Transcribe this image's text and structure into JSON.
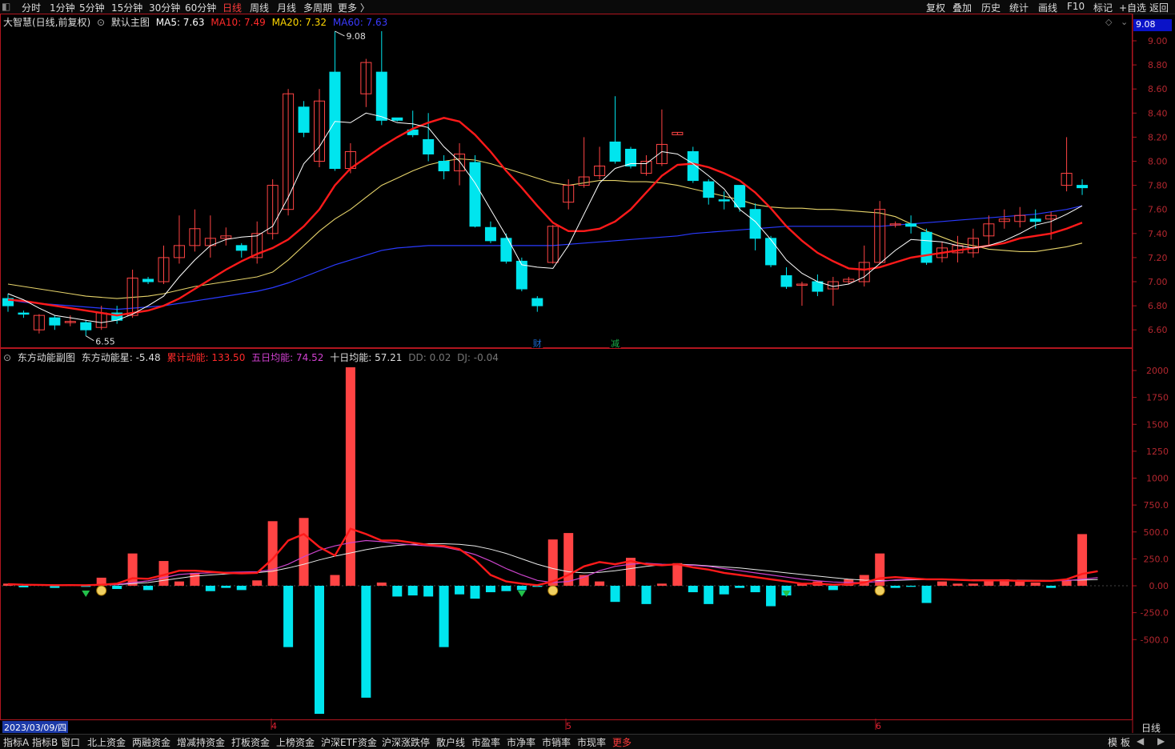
{
  "topbar": {
    "periods": [
      "分时",
      "1分钟",
      "5分钟",
      "15分钟",
      "30分钟",
      "60分钟",
      "日线",
      "周线",
      "月线",
      "多周期",
      "更多 〉"
    ],
    "active_period": "日线",
    "right_tools": [
      "复权",
      "叠加",
      "历史",
      "统计",
      "画线",
      "F10",
      "标记",
      "+自选",
      "返回"
    ]
  },
  "main": {
    "title": "大智慧(日线,前复权)",
    "template": "默认主图",
    "ma": [
      {
        "label": "MA5: 7.63",
        "color": "#ffffff"
      },
      {
        "label": "MA10: 7.49",
        "color": "#ff2a2a"
      },
      {
        "label": "MA20: 7.32",
        "color": "#ffd700"
      },
      {
        "label": "MA60: 7.63",
        "color": "#3a3aff"
      }
    ],
    "high_mark": "9.08",
    "low_mark": "6.55",
    "current_price": "9.08",
    "y_ticks": [
      "9.00",
      "8.80",
      "8.60",
      "8.40",
      "8.20",
      "8.00",
      "7.80",
      "7.60",
      "7.40",
      "7.20",
      "7.00",
      "6.80",
      "6.60"
    ],
    "events": [
      "财",
      "减"
    ]
  },
  "sub": {
    "title": "东方动能副图",
    "star_label": "东方动能星: -5.48",
    "cum_label": "累计动能: 133.50",
    "ma5_label": "五日均能: 74.52",
    "ma10_label": "十日均能: 57.21",
    "dd_label": "DD: 0.02",
    "dj_label": "DJ: -0.04",
    "y_ticks": [
      "2000",
      "1750",
      "1500",
      "1250",
      "1000",
      "750.0",
      "500.0",
      "250.0",
      "0.00",
      "-250.0",
      "-500.0"
    ]
  },
  "x_axis": {
    "date": "2023/03/09/四",
    "months": [
      "4",
      "5",
      "6"
    ],
    "period_label": "日线"
  },
  "bottombar": {
    "tabs": [
      "指标A",
      "指标B",
      "窗口",
      "北上资金",
      "两融资金",
      "增减持资金",
      "打板资金",
      "上榜资金",
      "沪深ETF资金",
      "沪深涨跌停",
      "散户线",
      "市盈率",
      "市净率",
      "市销率",
      "市现率",
      "更多"
    ],
    "right": [
      "模",
      "板"
    ]
  },
  "colors": {
    "up": "#ff4444",
    "down": "#00e5ee",
    "ma5": "#ffffff",
    "ma10": "#ff1a1a",
    "ma20": "#e6d36a",
    "ma60": "#2a3aff",
    "magenta": "#cc44cc",
    "axis": "#b0151f"
  },
  "chart_data": {
    "type": "candlestick",
    "candles": [
      [
        6.86,
        6.8,
        6.9,
        6.75
      ],
      [
        6.74,
        6.73,
        6.76,
        6.7
      ],
      [
        6.6,
        6.72,
        6.73,
        6.57
      ],
      [
        6.7,
        6.64,
        6.72,
        6.6
      ],
      [
        6.66,
        6.67,
        6.72,
        6.63
      ],
      [
        6.66,
        6.6,
        6.68,
        6.55
      ],
      [
        6.62,
        6.74,
        6.8,
        6.6
      ],
      [
        6.74,
        6.68,
        6.8,
        6.65
      ],
      [
        6.72,
        7.03,
        7.1,
        6.7
      ],
      [
        7.02,
        7.0,
        7.04,
        6.98
      ],
      [
        7.0,
        7.2,
        7.3,
        6.98
      ],
      [
        7.2,
        7.3,
        7.55,
        7.15
      ],
      [
        7.3,
        7.44,
        7.6,
        7.25
      ],
      [
        7.3,
        7.36,
        7.55,
        7.2
      ],
      [
        7.36,
        7.38,
        7.45,
        7.3
      ],
      [
        7.3,
        7.26,
        7.32,
        7.2
      ],
      [
        7.2,
        7.4,
        7.5,
        7.15
      ],
      [
        7.4,
        7.8,
        7.85,
        7.35
      ],
      [
        7.6,
        8.56,
        8.6,
        7.55
      ],
      [
        8.45,
        8.24,
        8.5,
        8.2
      ],
      [
        8.0,
        8.5,
        8.6,
        7.95
      ],
      [
        8.74,
        7.94,
        9.08,
        7.92
      ],
      [
        7.94,
        8.08,
        8.15,
        7.9
      ],
      [
        8.56,
        8.82,
        8.85,
        8.45
      ],
      [
        8.74,
        8.34,
        9.08,
        8.3
      ],
      [
        8.36,
        8.34,
        8.36,
        8.33
      ],
      [
        8.26,
        8.22,
        8.42,
        8.2
      ],
      [
        8.18,
        8.06,
        8.4,
        8.0
      ],
      [
        8.0,
        7.92,
        8.05,
        7.85
      ],
      [
        7.92,
        8.06,
        8.15,
        7.8
      ],
      [
        7.99,
        7.46,
        8.05,
        7.45
      ],
      [
        7.45,
        7.34,
        7.5,
        7.32
      ],
      [
        7.36,
        7.17,
        7.4,
        7.15
      ],
      [
        7.17,
        6.94,
        7.2,
        6.92
      ],
      [
        6.86,
        6.8,
        6.88,
        6.75
      ],
      [
        7.16,
        7.46,
        7.47,
        7.15
      ],
      [
        7.66,
        7.8,
        7.85,
        7.6
      ],
      [
        7.8,
        7.87,
        8.2,
        7.78
      ],
      [
        7.88,
        7.96,
        8.12,
        7.85
      ],
      [
        8.16,
        8.0,
        8.54,
        7.98
      ],
      [
        8.1,
        7.96,
        8.12,
        7.94
      ],
      [
        7.9,
        8.0,
        8.05,
        7.88
      ],
      [
        7.98,
        8.14,
        8.43,
        7.96
      ],
      [
        8.22,
        8.24,
        8.24,
        8.22
      ],
      [
        8.08,
        7.84,
        8.12,
        7.82
      ],
      [
        7.83,
        7.7,
        7.85,
        7.64
      ],
      [
        7.68,
        7.67,
        7.75,
        7.6
      ],
      [
        7.8,
        7.62,
        7.8,
        7.58
      ],
      [
        7.6,
        7.36,
        7.65,
        7.26
      ],
      [
        7.36,
        7.14,
        7.38,
        7.12
      ],
      [
        7.05,
        6.96,
        7.12,
        6.94
      ],
      [
        6.98,
        6.98,
        7.0,
        6.8
      ],
      [
        7.0,
        6.92,
        7.06,
        6.88
      ],
      [
        6.94,
        7.0,
        7.04,
        6.8
      ],
      [
        7.0,
        7.02,
        7.04,
        6.98
      ],
      [
        7.0,
        7.16,
        7.3,
        6.96
      ],
      [
        7.16,
        7.6,
        7.67,
        7.15
      ],
      [
        7.48,
        7.48,
        7.5,
        7.45
      ],
      [
        7.48,
        7.46,
        7.55,
        7.4
      ],
      [
        7.41,
        7.16,
        7.44,
        7.14
      ],
      [
        7.2,
        7.28,
        7.33,
        7.16
      ],
      [
        7.24,
        7.3,
        7.38,
        7.16
      ],
      [
        7.24,
        7.36,
        7.44,
        7.2
      ],
      [
        7.38,
        7.48,
        7.55,
        7.3
      ],
      [
        7.5,
        7.52,
        7.6,
        7.44
      ],
      [
        7.5,
        7.55,
        7.62,
        7.45
      ],
      [
        7.52,
        7.5,
        7.6,
        7.44
      ],
      [
        7.52,
        7.55,
        7.58,
        7.35
      ],
      [
        7.8,
        7.9,
        8.2,
        7.75
      ],
      [
        7.8,
        7.78,
        7.85,
        7.72
      ]
    ],
    "ma5": [
      6.9,
      6.85,
      6.78,
      6.72,
      6.7,
      6.68,
      6.66,
      6.68,
      6.73,
      6.8,
      6.88,
      7.04,
      7.18,
      7.3,
      7.35,
      7.37,
      7.38,
      7.46,
      7.7,
      7.98,
      8.12,
      8.33,
      8.32,
      8.4,
      8.37,
      8.32,
      8.31,
      8.28,
      8.12,
      8.0,
      7.82,
      7.6,
      7.38,
      7.14,
      7.12,
      7.11,
      7.3,
      7.56,
      7.82,
      7.94,
      7.98,
      7.98,
      8.08,
      8.06,
      7.98,
      7.88,
      7.77,
      7.6,
      7.5,
      7.35,
      7.18,
      7.07,
      7.0,
      6.96,
      6.98,
      7.04,
      7.15,
      7.26,
      7.35,
      7.34,
      7.33,
      7.3,
      7.28,
      7.3,
      7.34,
      7.4,
      7.47,
      7.5,
      7.56,
      7.63
    ],
    "ma10": [
      6.85,
      6.84,
      6.82,
      6.8,
      6.78,
      6.76,
      6.74,
      6.72,
      6.74,
      6.76,
      6.8,
      6.86,
      6.94,
      7.02,
      7.1,
      7.17,
      7.23,
      7.28,
      7.35,
      7.46,
      7.6,
      7.8,
      7.94,
      8.03,
      8.12,
      8.2,
      8.27,
      8.32,
      8.36,
      8.33,
      8.22,
      8.08,
      7.92,
      7.78,
      7.63,
      7.49,
      7.42,
      7.42,
      7.44,
      7.5,
      7.6,
      7.74,
      7.88,
      7.97,
      7.98,
      7.95,
      7.9,
      7.84,
      7.74,
      7.61,
      7.46,
      7.34,
      7.24,
      7.17,
      7.11,
      7.1,
      7.12,
      7.16,
      7.2,
      7.22,
      7.24,
      7.26,
      7.28,
      7.3,
      7.32,
      7.36,
      7.38,
      7.4,
      7.44,
      7.49
    ],
    "ma20": [
      6.98,
      6.96,
      6.94,
      6.92,
      6.9,
      6.88,
      6.87,
      6.86,
      6.87,
      6.88,
      6.9,
      6.93,
      6.96,
      6.98,
      7.0,
      7.02,
      7.04,
      7.08,
      7.18,
      7.3,
      7.42,
      7.52,
      7.6,
      7.7,
      7.8,
      7.86,
      7.92,
      7.97,
      8.0,
      8.02,
      8.01,
      7.98,
      7.94,
      7.9,
      7.86,
      7.82,
      7.8,
      7.82,
      7.84,
      7.84,
      7.83,
      7.83,
      7.82,
      7.8,
      7.77,
      7.74,
      7.71,
      7.68,
      7.64,
      7.62,
      7.61,
      7.61,
      7.6,
      7.6,
      7.59,
      7.58,
      7.57,
      7.54,
      7.48,
      7.42,
      7.37,
      7.32,
      7.3,
      7.27,
      7.26,
      7.25,
      7.25,
      7.27,
      7.29,
      7.32
    ],
    "ma60": [
      6.85,
      6.83,
      6.82,
      6.81,
      6.8,
      6.79,
      6.78,
      6.77,
      6.78,
      6.79,
      6.8,
      6.82,
      6.84,
      6.86,
      6.88,
      6.9,
      6.92,
      6.95,
      6.99,
      7.04,
      7.09,
      7.14,
      7.18,
      7.22,
      7.26,
      7.28,
      7.29,
      7.3,
      7.3,
      7.3,
      7.3,
      7.3,
      7.3,
      7.3,
      7.3,
      7.3,
      7.31,
      7.32,
      7.33,
      7.34,
      7.35,
      7.36,
      7.37,
      7.38,
      7.4,
      7.41,
      7.42,
      7.43,
      7.44,
      7.45,
      7.46,
      7.46,
      7.46,
      7.46,
      7.46,
      7.46,
      7.46,
      7.47,
      7.48,
      7.49,
      7.5,
      7.51,
      7.52,
      7.53,
      7.54,
      7.55,
      7.56,
      7.58,
      7.6,
      7.63
    ],
    "bars": [
      20,
      -15,
      10,
      -20,
      10,
      -10,
      75,
      -30,
      300,
      -40,
      230,
      40,
      120,
      -50,
      -20,
      -40,
      50,
      600,
      -570,
      630,
      -1190,
      100,
      2030,
      -1040,
      30,
      -100,
      -90,
      -100,
      -570,
      -80,
      -120,
      -60,
      -50,
      -40,
      -10,
      430,
      490,
      100,
      40,
      -150,
      260,
      -170,
      20,
      210,
      -60,
      -170,
      -80,
      -20,
      -60,
      -190,
      -90,
      20,
      40,
      -40,
      60,
      100,
      300,
      -20,
      -10,
      -160,
      40,
      20,
      20,
      50,
      60,
      40,
      30,
      -20,
      50,
      480,
      20
    ],
    "cum": [
      15,
      10,
      8,
      5,
      6,
      5,
      10,
      20,
      70,
      65,
      100,
      140,
      140,
      130,
      120,
      115,
      120,
      250,
      420,
      480,
      360,
      280,
      530,
      480,
      420,
      420,
      400,
      380,
      370,
      340,
      240,
      100,
      40,
      20,
      5,
      40,
      100,
      180,
      220,
      200,
      230,
      200,
      190,
      200,
      170,
      150,
      120,
      100,
      80,
      60,
      40,
      20,
      20,
      10,
      15,
      30,
      70,
      80,
      70,
      60,
      60,
      55,
      50,
      50,
      50,
      45,
      45,
      45,
      60,
      110,
      135
    ],
    "ma5e": [
      10,
      8,
      7,
      6,
      6,
      6,
      8,
      12,
      30,
      45,
      75,
      105,
      115,
      120,
      125,
      128,
      130,
      150,
      200,
      270,
      330,
      370,
      400,
      420,
      410,
      390,
      380,
      370,
      360,
      330,
      290,
      230,
      160,
      100,
      50,
      30,
      40,
      80,
      140,
      180,
      200,
      210,
      200,
      195,
      190,
      180,
      160,
      140,
      120,
      100,
      80,
      60,
      45,
      35,
      30,
      30,
      40,
      55,
      60,
      60,
      60,
      55,
      50,
      50,
      50,
      48,
      46,
      45,
      48,
      60,
      75
    ],
    "ma10e": [
      10,
      9,
      8,
      8,
      7,
      7,
      8,
      10,
      20,
      30,
      50,
      70,
      90,
      100,
      110,
      118,
      122,
      135,
      165,
      200,
      240,
      275,
      305,
      335,
      360,
      375,
      385,
      390,
      390,
      385,
      370,
      340,
      300,
      250,
      200,
      160,
      130,
      120,
      125,
      140,
      160,
      180,
      195,
      200,
      195,
      185,
      175,
      165,
      150,
      135,
      120,
      105,
      90,
      75,
      62,
      52,
      48,
      50,
      55,
      58,
      60,
      58,
      56,
      55,
      54,
      52,
      50,
      49,
      50,
      53,
      57
    ]
  }
}
